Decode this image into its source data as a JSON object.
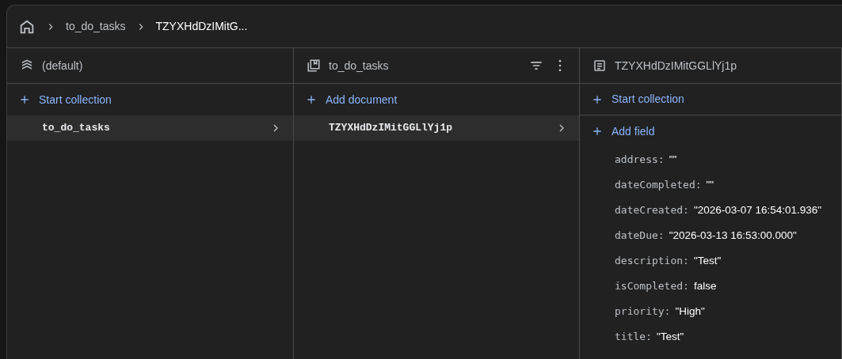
{
  "breadcrumb": [
    {
      "label": "to_do_tasks",
      "current": false
    },
    {
      "label": "TZYXHdDzIMitG...",
      "current": true
    }
  ],
  "columns": [
    {
      "kind": "database",
      "title": "(default)",
      "actions": [
        "Start collection"
      ],
      "items": [
        {
          "label": "to_do_tasks",
          "selected": true
        }
      ]
    },
    {
      "kind": "collection",
      "title": "to_do_tasks",
      "actions": [
        "Add document"
      ],
      "items": [
        {
          "label": "TZYXHdDzIMitGGLlYj1p",
          "selected": true
        }
      ]
    },
    {
      "kind": "document",
      "title": "TZYXHdDzIMitGGLlYj1p",
      "actions": [
        "Start collection",
        "Add field"
      ],
      "fields": [
        {
          "key": "address:",
          "value": "\"\""
        },
        {
          "key": "dateCompleted:",
          "value": "\"\""
        },
        {
          "key": "dateCreated:",
          "value": "\"2026-03-07 16:54:01.936\""
        },
        {
          "key": "dateDue:",
          "value": "\"2026-03-13 16:53:00.000\""
        },
        {
          "key": "description:",
          "value": "\"Test\""
        },
        {
          "key": "isCompleted:",
          "value": "false"
        },
        {
          "key": "priority:",
          "value": "\"High\""
        },
        {
          "key": "title:",
          "value": "\"Test\""
        }
      ]
    }
  ]
}
